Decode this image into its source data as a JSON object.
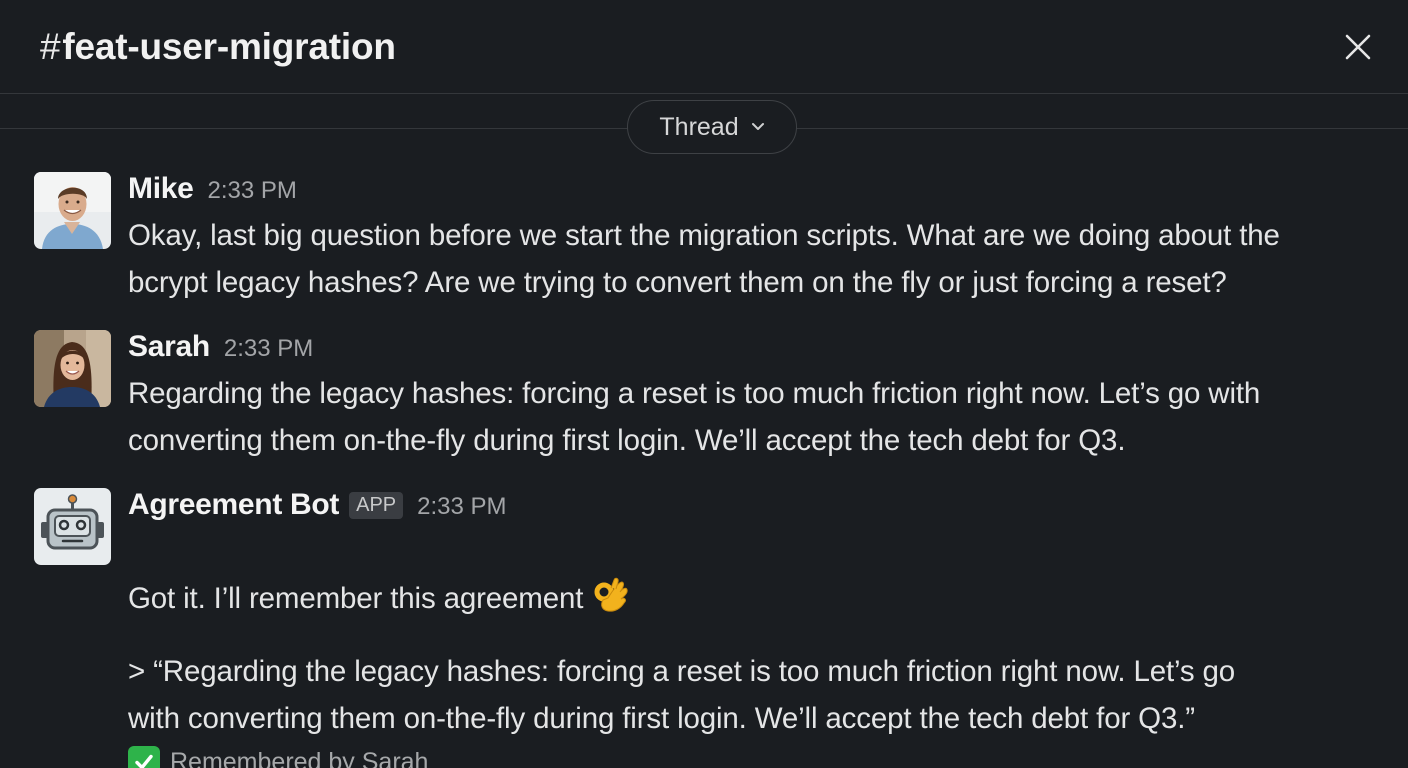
{
  "header": {
    "hash": "#",
    "channel_name": "feat-user-migration"
  },
  "thread_label": "Thread",
  "messages": [
    {
      "author": "Mike",
      "time": "2:33 PM",
      "text": "Okay, last big question before we start the migration scripts. What are we doing about the\nbcrypt legacy hashes? Are we trying to convert them on the fly or just forcing a reset?"
    },
    {
      "author": "Sarah",
      "time": "2:33 PM",
      "text": "Regarding the legacy hashes: forcing a reset is too much friction right now. Let’s go with\nconverting them on-the-fly during first login. We’ll accept the tech debt for Q3."
    },
    {
      "author": "Agreement Bot",
      "badge": "APP",
      "time": "2:33 PM",
      "text": "Got it. I’ll remember this agreement",
      "quote": "> “Regarding the legacy hashes: forcing a reset is too much friction right now. Let’s go\nwith converting them on-the-fly during first login. We’ll accept the tech debt for Q3.”",
      "remembered": "Remembered by Sarah"
    }
  ],
  "icons": {
    "close": "close-icon",
    "chevron": "chevron-down-icon",
    "emoji": "ok-hand-emoji",
    "check": "check-mark-icon"
  },
  "colors": {
    "background": "#1a1d21",
    "check_green": "#2eb34a"
  }
}
